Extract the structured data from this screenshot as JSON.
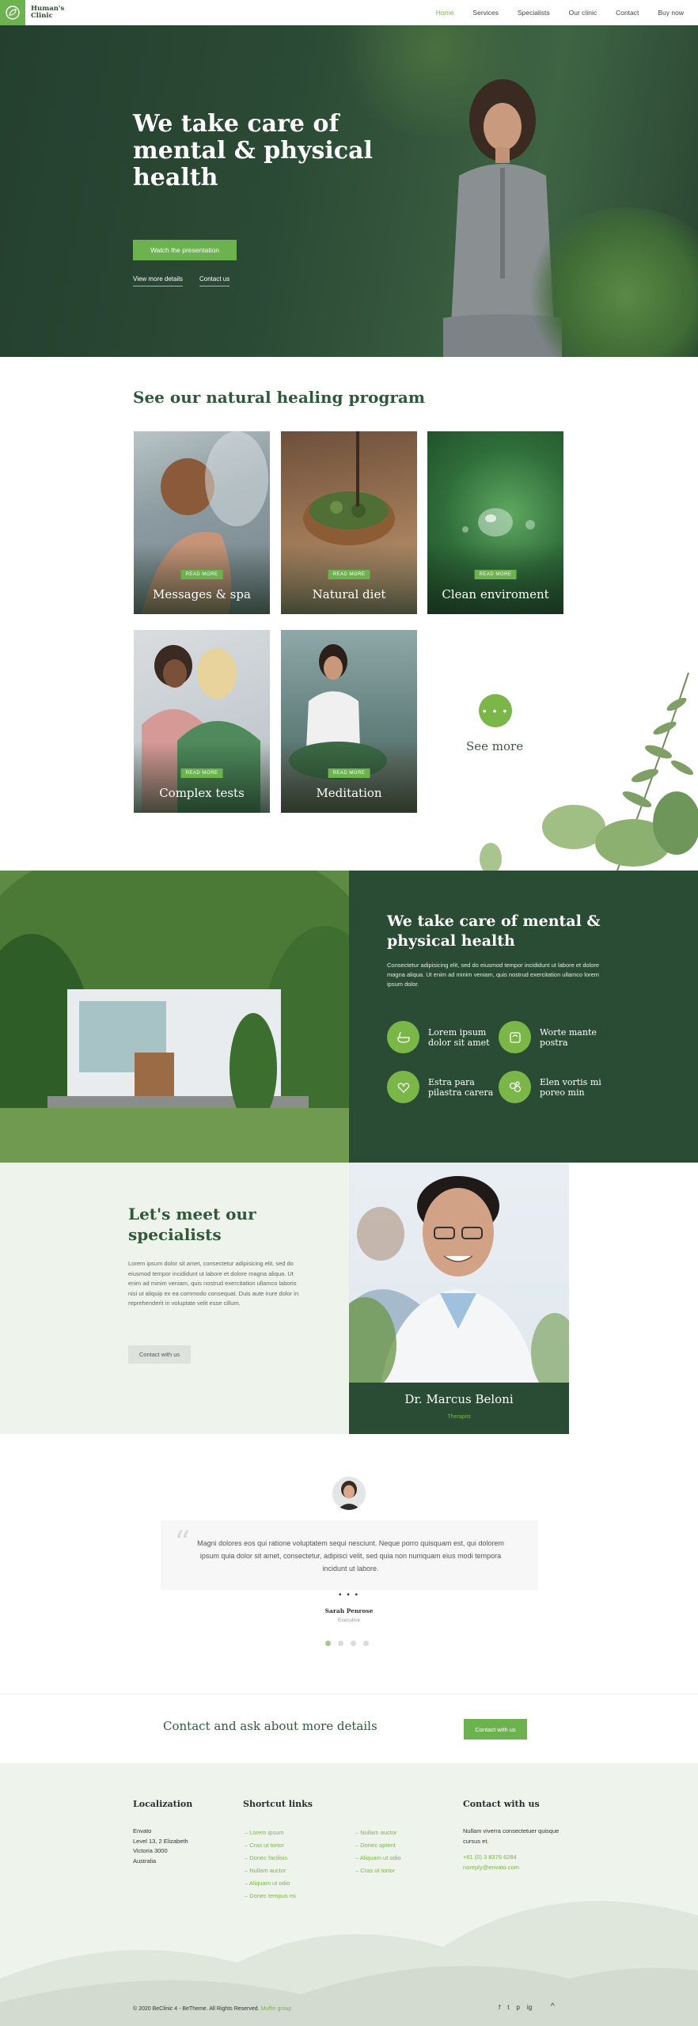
{
  "header": {
    "logo_line1": "Human's",
    "logo_line2": "Clinic",
    "nav": [
      "Home",
      "Services",
      "Specialists",
      "Our clinic",
      "Contact",
      "Buy now"
    ]
  },
  "hero": {
    "title": "We take care of mental & physical health",
    "button": "Watch the presentation",
    "link1": "View more details",
    "link2": "Contact us"
  },
  "programs": {
    "title": "See our natural healing program",
    "tag": "READ MORE",
    "cards": [
      "Messages & spa",
      "Natural diet",
      "Clean enviroment",
      "Complex tests",
      "Meditation"
    ],
    "see_more_dots": "• • •",
    "see_more": "See more"
  },
  "care": {
    "title": "We take care of mental & physical health",
    "text": "Consectetur adipisicing elit, sed do eiusmod tempor incididunt ut labore et dolore magna aliqua. Ut enim ad minim veniam, quis nostrud exercitation ullamco lorem ipsum dolor.",
    "features": [
      "Lorem ipsum dolor sit amet",
      "Worte mante postra",
      "Estra para pilastra carera",
      "Elen vortis mi poreo min"
    ]
  },
  "specialists": {
    "title": "Let's meet our specialists",
    "text": "Lorem ipsum dolor sit amet, consectetur adipisicing elit, sed do eiusmod tempor incididunt ut labore et dolore magna aliqua. Ut enim ad minim veniam, quis nostrud exercitation ullamco laboris nisi ut aliquip ex ea commodo consequat. Duis aute irure dolor in reprehenderit in voluptate velit esse cillum.",
    "button": "Contact with us",
    "doctor_name": "Dr. Marcus Beloni",
    "doctor_role": "Therapist"
  },
  "testimonial": {
    "quote": "Magni dolores eos qui ratione voluptatem sequi nesciunt. Neque porro quisquam est, qui dolorem ipsum quia dolor sit amet, consectetur, adipisci velit, sed quia non numquam eius modi tempora incidunt ut labore.",
    "dots": "• • •",
    "name": "Sarah Penrose",
    "role": "Executive"
  },
  "cta": {
    "text": "Contact and ask about more details",
    "button": "Contact with us"
  },
  "footer": {
    "loc_title": "Localization",
    "loc_lines": [
      "Envato",
      "Level 13, 2 Elizabeth",
      "Victoria 3000",
      "Australia"
    ],
    "links_title": "Shortcut links",
    "links_col1": [
      "Lorem ipsum",
      "Cras ut tortor",
      "Donec facilisis",
      "Nullam auctor",
      "Aliquam ut odio",
      "Donec tempus mi"
    ],
    "links_col2": [
      "Nullam auctor",
      "Donec aptent",
      "Aliquam ut odio",
      "Cras ut tortor"
    ],
    "contact_title": "Contact with us",
    "contact_text": "Nullam viverra consectetuer quisque cursus et.",
    "phone": "+61 (0) 3 8376 6284",
    "email": "noreply@envato.com",
    "copyright": "© 2020 BeClinic 4 - BeTheme. All Rights Reserved.",
    "copyright_brand": "Muffin group",
    "social": [
      "f",
      "t",
      "p",
      "ig"
    ],
    "up": "^"
  },
  "colors": {
    "accent": "#6cb24f",
    "dark_green": "#2b4c34",
    "heading_green": "#2f5a3a",
    "light_bg": "#eef3ec"
  }
}
